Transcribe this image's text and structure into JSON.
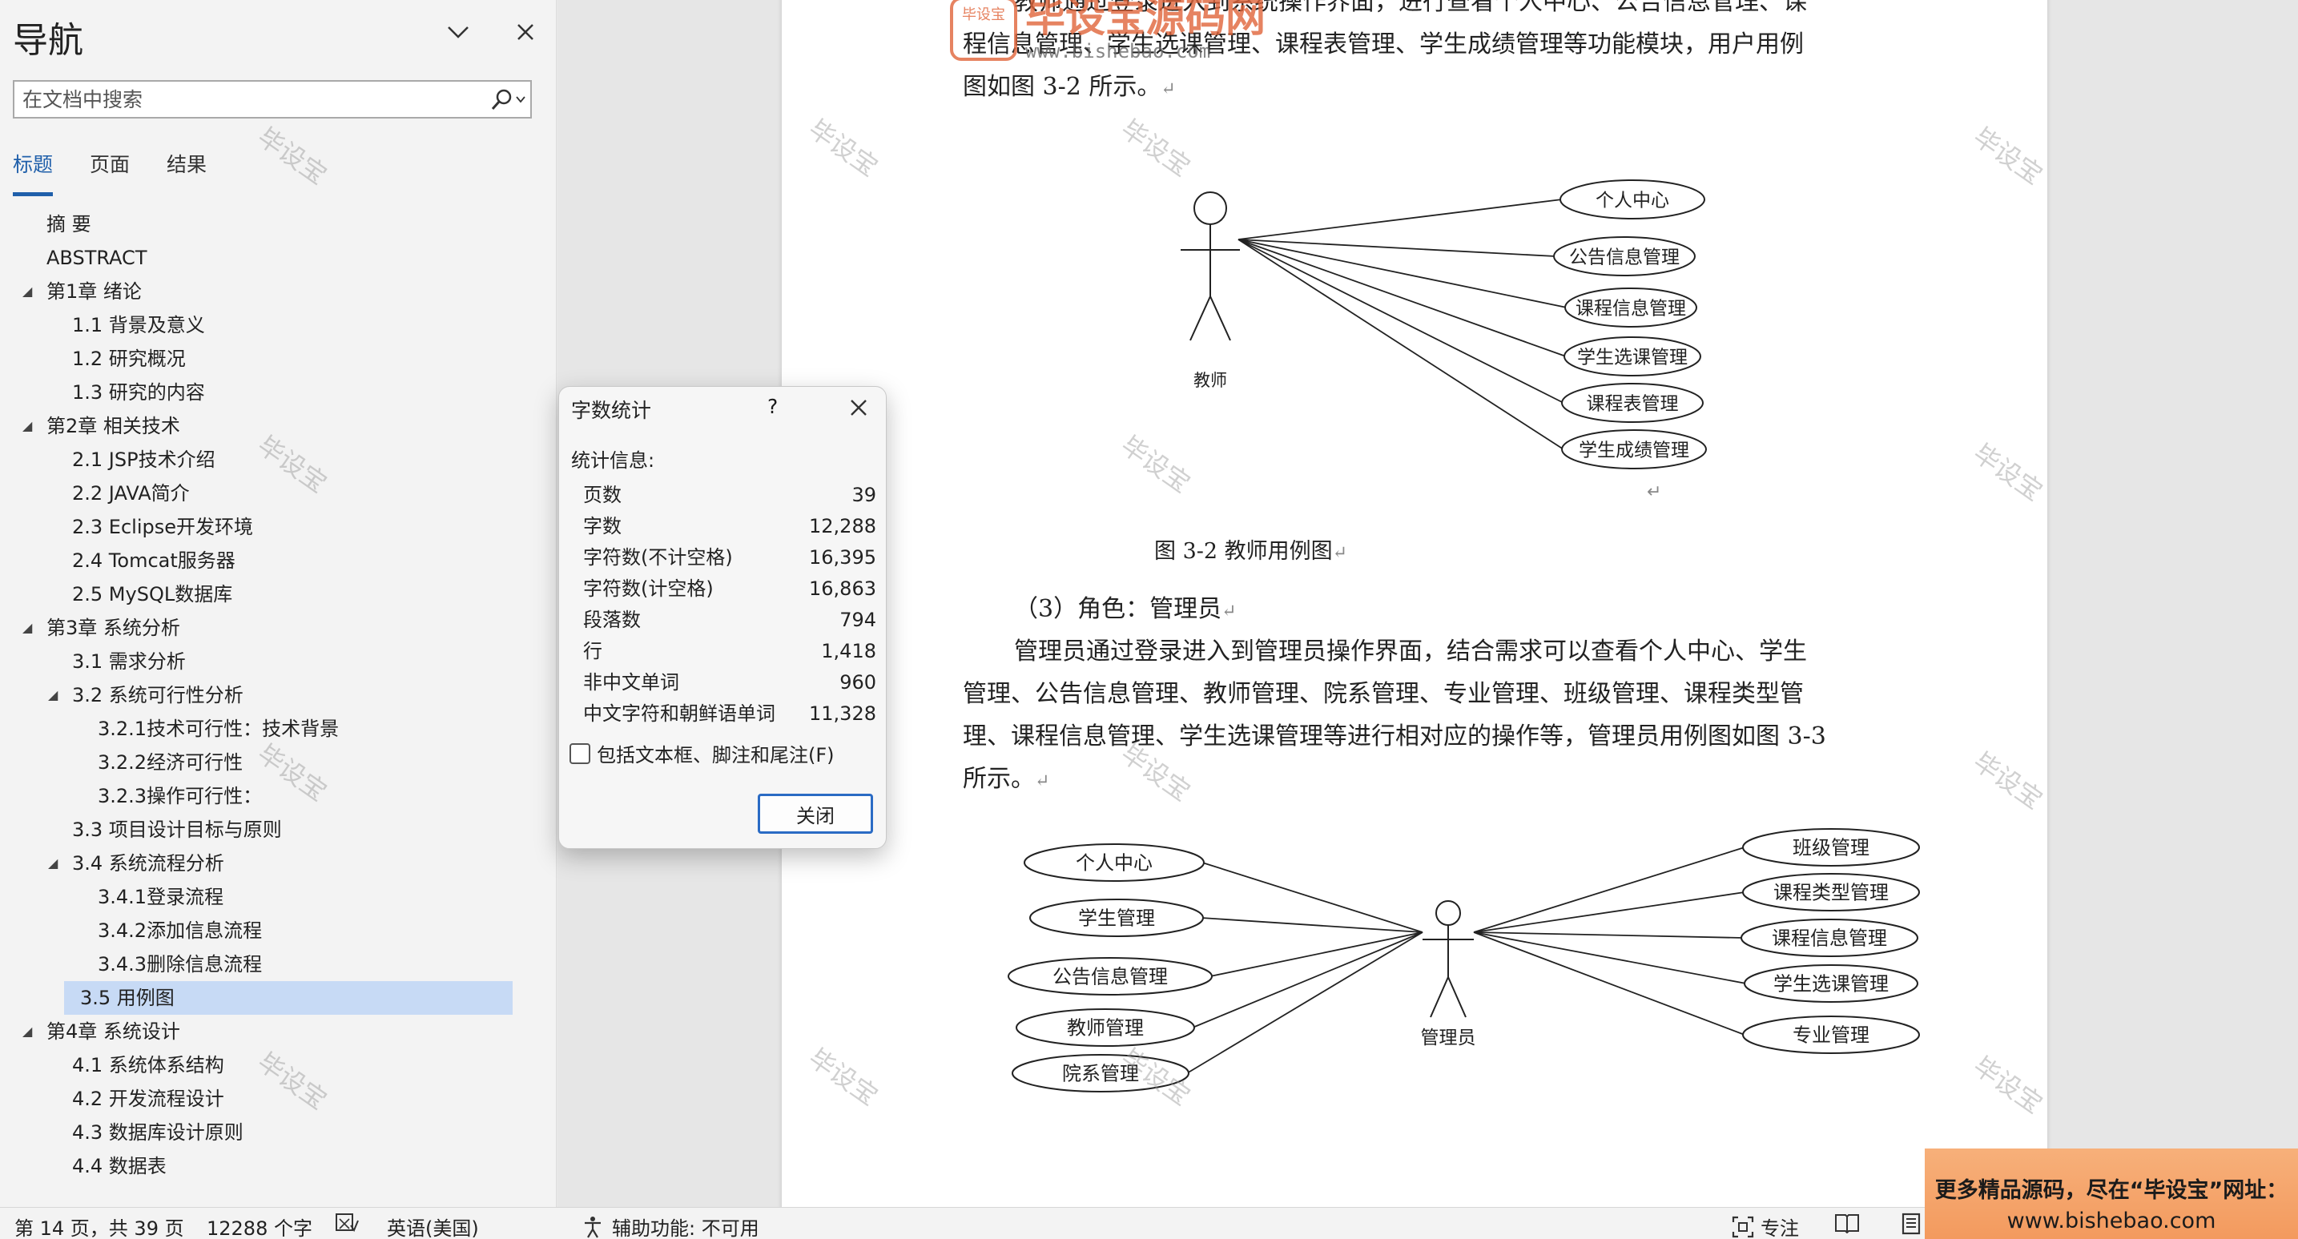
{
  "nav": {
    "title": "导航",
    "search_placeholder": "在文档中搜索",
    "tabs": [
      "标题",
      "页面",
      "结果"
    ],
    "tree": [
      {
        "label": "摘  要",
        "level": 0,
        "arrow": false
      },
      {
        "label": "ABSTRACT",
        "level": 0,
        "arrow": false
      },
      {
        "label": "第1章 绪论",
        "level": 0,
        "arrow": true
      },
      {
        "label": "1.1 背景及意义",
        "level": 1,
        "arrow": false
      },
      {
        "label": "1.2 研究概况",
        "level": 1,
        "arrow": false
      },
      {
        "label": "1.3 研究的内容",
        "level": 1,
        "arrow": false
      },
      {
        "label": "第2章 相关技术",
        "level": 0,
        "arrow": true
      },
      {
        "label": "2.1 JSP技术介绍",
        "level": 1,
        "arrow": false
      },
      {
        "label": "2.2 JAVA简介",
        "level": 1,
        "arrow": false
      },
      {
        "label": "2.3 Eclipse开发环境",
        "level": 1,
        "arrow": false
      },
      {
        "label": "2.4 Tomcat服务器",
        "level": 1,
        "arrow": false
      },
      {
        "label": "2.5 MySQL数据库",
        "level": 1,
        "arrow": false
      },
      {
        "label": "第3章 系统分析",
        "level": 0,
        "arrow": true
      },
      {
        "label": "3.1 需求分析",
        "level": 1,
        "arrow": false
      },
      {
        "label": "3.2 系统可行性分析",
        "level": 1,
        "arrow": true
      },
      {
        "label": "3.2.1技术可行性：技术背景",
        "level": 2,
        "arrow": false
      },
      {
        "label": "3.2.2经济可行性",
        "level": 2,
        "arrow": false
      },
      {
        "label": "3.2.3操作可行性：",
        "level": 2,
        "arrow": false
      },
      {
        "label": "3.3 项目设计目标与原则",
        "level": 1,
        "arrow": false
      },
      {
        "label": "3.4 系统流程分析",
        "level": 1,
        "arrow": true
      },
      {
        "label": "3.4.1登录流程",
        "level": 2,
        "arrow": false
      },
      {
        "label": "3.4.2添加信息流程",
        "level": 2,
        "arrow": false
      },
      {
        "label": "3.4.3删除信息流程",
        "level": 2,
        "arrow": false
      },
      {
        "label": "3.5 用例图",
        "level": 1,
        "arrow": false,
        "selected": true
      },
      {
        "label": "第4章 系统设计",
        "level": 0,
        "arrow": true
      },
      {
        "label": "4.1 系统体系结构",
        "level": 1,
        "arrow": false
      },
      {
        "label": "4.2 开发流程设计",
        "level": 1,
        "arrow": false
      },
      {
        "label": "4.3 数据库设计原则",
        "level": 1,
        "arrow": false
      },
      {
        "label": "4.4 数据表",
        "level": 1,
        "arrow": false
      }
    ]
  },
  "document": {
    "top_paragraph_lines": [
      "教师通过登录进入到系统操作界面，进行查看个人中心、公告信息管理、课",
      "程信息管理、学生选课管理、课程表管理、学生成绩管理等功能模块，用户用例",
      "图如图 3-2 所示。"
    ],
    "logo_watermark": {
      "seal": "毕设宝",
      "brand": "毕设宝源码网",
      "url": "www.bishebao.com"
    },
    "watermark_text": "毕设宝",
    "return_mark": "↵",
    "figure1": {
      "actor": "教师",
      "use_cases": [
        "个人中心",
        "公告信息管理",
        "课程信息管理",
        "学生选课管理",
        "课程表管理",
        "学生成绩管理"
      ],
      "caption": "图 3-2 教师用例图"
    },
    "section_heading": "（3）角色：管理员",
    "paragraph2_lines": [
      "管理员通过登录进入到管理员操作界面，结合需求可以查看个人中心、学生",
      "管理、公告信息管理、教师管理、院系管理、专业管理、班级管理、课程类型管",
      "理、课程信息管理、学生选课管理等进行相对应的操作等，管理员用例图如图 3-3",
      "所示。"
    ],
    "figure2": {
      "actor": "管理员",
      "left_use_cases": [
        "个人中心",
        "学生管理",
        "公告信息管理",
        "教师管理",
        "院系管理"
      ],
      "right_use_cases": [
        "班级管理",
        "课程类型管理",
        "课程信息管理",
        "学生选课管理",
        "专业管理"
      ]
    }
  },
  "dialog": {
    "title": "字数统计",
    "help": "?",
    "stats_label": "统计信息:",
    "rows": [
      {
        "label": "页数",
        "value": "39"
      },
      {
        "label": "字数",
        "value": "12,288"
      },
      {
        "label": "字符数(不计空格)",
        "value": "16,395"
      },
      {
        "label": "字符数(计空格)",
        "value": "16,863"
      },
      {
        "label": "段落数",
        "value": "794"
      },
      {
        "label": "行",
        "value": "1,418"
      },
      {
        "label": "非中文单词",
        "value": "960"
      },
      {
        "label": "中文字符和朝鲜语单词",
        "value": "11,328"
      }
    ],
    "checkbox_label": "包括文本框、脚注和尾注(F)",
    "close_button": "关闭"
  },
  "status": {
    "page": "第 14 页，共 39 页",
    "words": "12288 个字",
    "language": "英语(美国)",
    "accessibility": "辅助功能: 不可用",
    "focus": "专注"
  },
  "promo": {
    "line1": "更多精品源码，尽在“毕设宝”网址：",
    "line2": "www.bishebao.com"
  }
}
